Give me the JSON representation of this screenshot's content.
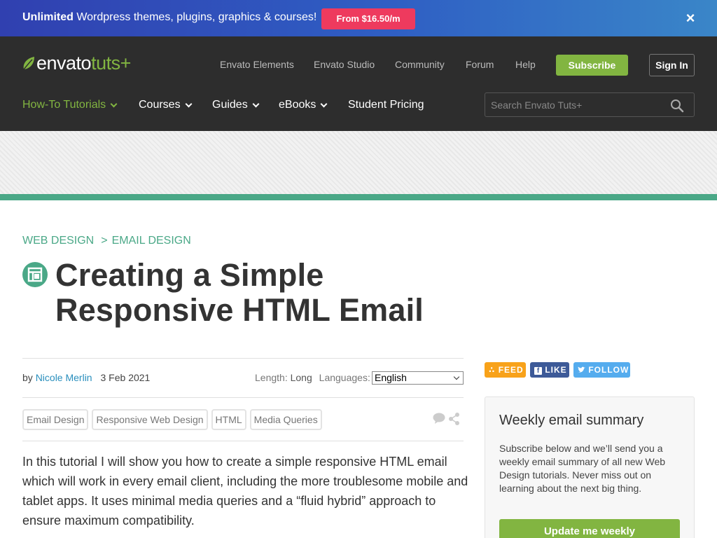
{
  "promo": {
    "bold": "Unlimited",
    "text": " Wordpress themes, plugins, graphics & courses!",
    "cta": "From $16.50/m"
  },
  "header": {
    "logo_envato": "envato",
    "logo_tuts": "tuts+",
    "top_links": [
      "Envato Elements",
      "Envato Studio",
      "Community",
      "Forum",
      "Help"
    ],
    "subscribe": "Subscribe",
    "sign_in": "Sign In",
    "main_nav": [
      {
        "label": "How-To Tutorials"
      },
      {
        "label": "Courses"
      },
      {
        "label": "Guides"
      },
      {
        "label": "eBooks"
      },
      {
        "label": "Student Pricing"
      }
    ],
    "search_placeholder": "Search Envato Tuts+"
  },
  "article": {
    "breadcrumbs": [
      "Web Design",
      "Email Design"
    ],
    "breadcrumb_separator": ">",
    "title_line1": "Creating a Simple",
    "title_line2": "Responsive HTML Email",
    "by": "by",
    "author": "Nicole Merlin",
    "date": "3 Feb 2021",
    "length_label": "Length:",
    "length_value": "Long",
    "languages_label": "Languages:",
    "language_selected": "English",
    "tags": [
      "Email Design",
      "Responsive Web Design",
      "HTML",
      "Media Queries"
    ],
    "intro": "In this tutorial I will show you how to create a simple responsive HTML email which will work in every email client, including the more troublesome mobile and tablet apps. It uses minimal media queries and a “fluid hybrid” approach to ensure maximum compatibility."
  },
  "sidebar": {
    "feed": "FEED",
    "like": "LIKE",
    "follow": "FOLLOW",
    "panel_title": "Weekly email summary",
    "panel_text": "Subscribe below and we’ll send you a weekly email summary of all new Web Design tutorials. Never miss out on learning about the next big thing.",
    "panel_button": "Update me weekly"
  },
  "colors": {
    "accent_green": "#82b541",
    "teal": "#4aa887",
    "promo_button": "#ee3a5e",
    "header_bg": "#2d2d2d",
    "feed": "#f8a21a",
    "like": "#3d5a98",
    "follow": "#55acee"
  }
}
